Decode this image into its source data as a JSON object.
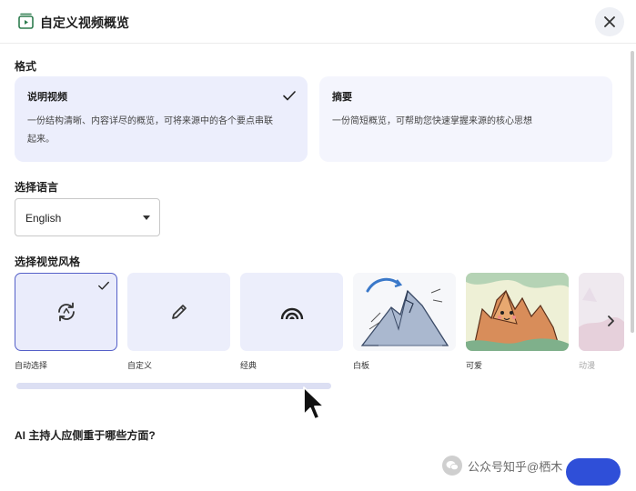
{
  "dialog": {
    "title": "自定义视频概览"
  },
  "format": {
    "section_label": "格式",
    "options": [
      {
        "name": "说明视频",
        "description_line1": "一份结构清晰、内容详尽的概览，可将来源中的各个要点串联",
        "description_line2": "起来。",
        "selected": true
      },
      {
        "name": "摘要",
        "description_line1": "一份简短概览，可帮助您快速掌握来源的核心思想",
        "description_line2": "",
        "selected": false
      }
    ]
  },
  "language": {
    "section_label": "选择语言",
    "selected_value": "English"
  },
  "visual_style": {
    "section_label": "选择视觉风格",
    "options": [
      {
        "label": "自动选择",
        "icon": "auto-refresh-icon",
        "selected": true
      },
      {
        "label": "自定义",
        "icon": "pencil-icon",
        "selected": false
      },
      {
        "label": "经典",
        "icon": "rainbow-arcs-icon",
        "selected": false
      },
      {
        "label": "白板",
        "icon": "whiteboard-volcano-illustration",
        "selected": false
      },
      {
        "label": "可爱",
        "icon": "cute-mountains-illustration",
        "selected": false
      },
      {
        "label": "动漫",
        "icon": "anime-illustration",
        "selected": false
      }
    ]
  },
  "host_focus": {
    "section_label": "AI 主持人应侧重于哪些方面?"
  },
  "watermark": {
    "text": "公众号知乎@栖木"
  },
  "colors": {
    "accent": "#5560c8",
    "card_bg": "#eceefb",
    "primary_button": "#2f4fd8"
  }
}
